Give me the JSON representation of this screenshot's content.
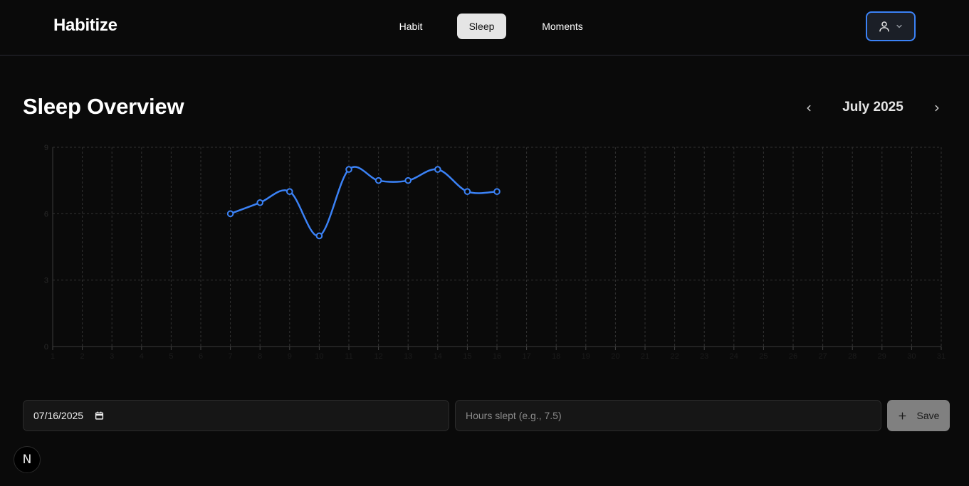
{
  "app": {
    "brand": "Habitize"
  },
  "nav": {
    "items": [
      "Habit",
      "Sleep",
      "Moments"
    ],
    "active": "Sleep"
  },
  "user_menu": {
    "icon": "user-icon",
    "chevron": "chevron-down-icon",
    "accent": "#3b82f6"
  },
  "page": {
    "title": "Sleep Overview"
  },
  "month_nav": {
    "label": "July 2025",
    "prev_icon": "chevron-left-icon",
    "next_icon": "chevron-right-icon"
  },
  "chart_data": {
    "type": "line",
    "x": [
      7,
      8,
      9,
      10,
      11,
      12,
      13,
      14,
      15,
      16
    ],
    "y": [
      6,
      6.5,
      7,
      5,
      8,
      7.5,
      7.5,
      8,
      7,
      7
    ],
    "xticks": [
      1,
      2,
      3,
      4,
      5,
      6,
      7,
      8,
      9,
      10,
      11,
      12,
      13,
      14,
      15,
      16,
      17,
      18,
      19,
      20,
      21,
      22,
      23,
      24,
      25,
      26,
      27,
      28,
      29,
      30,
      31
    ],
    "yticks": [
      0,
      3,
      6,
      9
    ],
    "xlim": [
      1,
      31
    ],
    "ylim": [
      0,
      9
    ],
    "grid": true,
    "line_color": "#3b82f6"
  },
  "form": {
    "date_value": "07/16/2025",
    "hours_placeholder": "Hours slept (e.g., 7.5)",
    "save_label": "Save",
    "save_icon": "plus-icon",
    "calendar_icon": "calendar-icon"
  },
  "badge": {
    "letter": "N"
  }
}
